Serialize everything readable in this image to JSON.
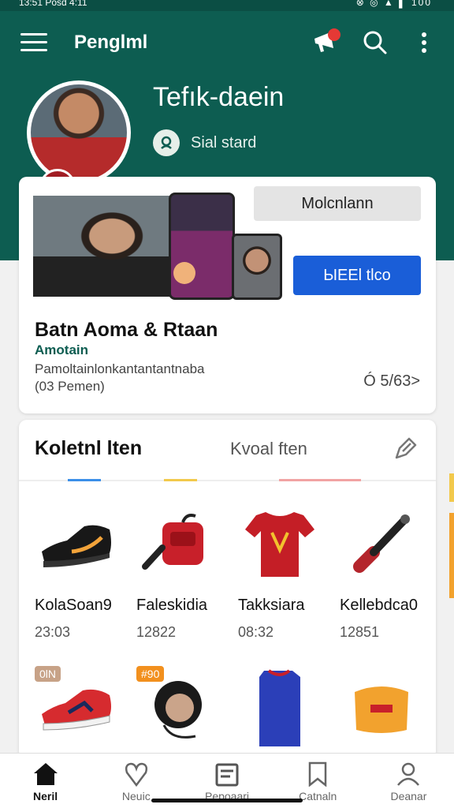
{
  "status": {
    "time": "13:51 Posd 4:11",
    "icons": "⊗ ◎ ▲ ▌ 100"
  },
  "appbar": {
    "title": "Penglml"
  },
  "profile": {
    "name": "Tefık-daein",
    "subtitle": "Sial stard"
  },
  "featured": {
    "follow_label": "Molcnlann",
    "primary_label": "ЫЕЕl tlco",
    "title": "Batn Aoma & Rtaan",
    "subtitle": "Amotain",
    "description": "Pamoltainlonkantantantnaba",
    "count": "(03 Pemen)",
    "stats": "Ó 5/63>"
  },
  "collection": {
    "tab_active": "Koletnl lten",
    "tab_inactive": "Kvoal ften",
    "products": [
      {
        "name": "KolaSoan9",
        "price": "23:03",
        "icon": "sneaker-icon"
      },
      {
        "name": "Faleskidia",
        "price": "12822",
        "icon": "bag-icon"
      },
      {
        "name": "Takksiara",
        "price": "08:32",
        "icon": "jersey-icon"
      },
      {
        "name": "Kellebdca0",
        "price": "12851",
        "icon": "torch-icon"
      },
      {
        "name": "",
        "price": "",
        "icon": "running-shoe-icon",
        "badge": "0lN"
      },
      {
        "name": "",
        "price": "",
        "icon": "headphones-icon",
        "badge": "#90"
      },
      {
        "name": "",
        "price": "",
        "icon": "blue-jersey-icon"
      },
      {
        "name": "",
        "price": "",
        "icon": "box-icon"
      }
    ]
  },
  "bottom_nav": [
    {
      "label": "Neril",
      "icon": "home-icon",
      "active": true
    },
    {
      "label": "Neuic",
      "icon": "heart-icon"
    },
    {
      "label": "Pepoaari",
      "icon": "wallet-icon"
    },
    {
      "label": "Catnaln",
      "icon": "bookmark-icon"
    },
    {
      "label": "Deanar",
      "icon": "profile-icon"
    }
  ],
  "colors": {
    "header": "#0d5d51",
    "primary": "#1a5ed8",
    "accent": "#e53935"
  }
}
